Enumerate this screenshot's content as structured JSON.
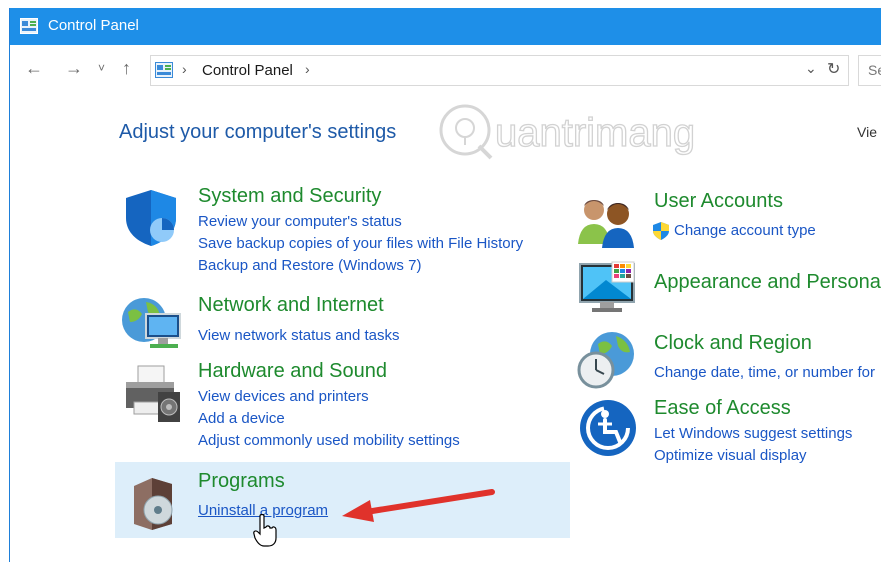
{
  "window": {
    "title": "Control Panel"
  },
  "address": {
    "path": "Control Panel",
    "search_placeholder": "Se"
  },
  "main": {
    "heading": "Adjust your computer's settings",
    "view_by": "Vie"
  },
  "watermark": "uantrimang",
  "left_categories": [
    {
      "title": "System and Security",
      "links": [
        "Review your computer's status",
        "Save backup copies of your files with File History",
        "Backup and Restore (Windows 7)"
      ]
    },
    {
      "title": "Network and Internet",
      "links": [
        "View network status and tasks"
      ]
    },
    {
      "title": "Hardware and Sound",
      "links": [
        "View devices and printers",
        "Add a device",
        "Adjust commonly used mobility settings"
      ]
    },
    {
      "title": "Programs",
      "links": [
        "Uninstall a program"
      ]
    }
  ],
  "right_categories": [
    {
      "title": "User Accounts",
      "links": [
        "Change account type"
      ]
    },
    {
      "title": "Appearance and Personal",
      "links": []
    },
    {
      "title": "Clock and Region",
      "links": [
        "Change date, time, or number for"
      ]
    },
    {
      "title": "Ease of Access",
      "links": [
        "Let Windows suggest settings",
        "Optimize visual display"
      ]
    }
  ],
  "colors": {
    "titlebar": "#1e8fe8",
    "category_title": "#1e8a2e",
    "link": "#1a56c5",
    "heading": "#1e5aa8",
    "annotation_arrow": "#e0322b"
  },
  "icons": [
    "control-panel-icon",
    "back-arrow-icon",
    "forward-arrow-icon",
    "up-arrow-icon",
    "refresh-icon",
    "shield-icon",
    "network-globe-icon",
    "printer-icon",
    "programs-disc-icon",
    "users-icon",
    "monitor-palette-icon",
    "clock-globe-icon",
    "ease-of-access-icon",
    "uac-shield-icon",
    "hand-cursor-icon",
    "red-arrow-annotation"
  ]
}
